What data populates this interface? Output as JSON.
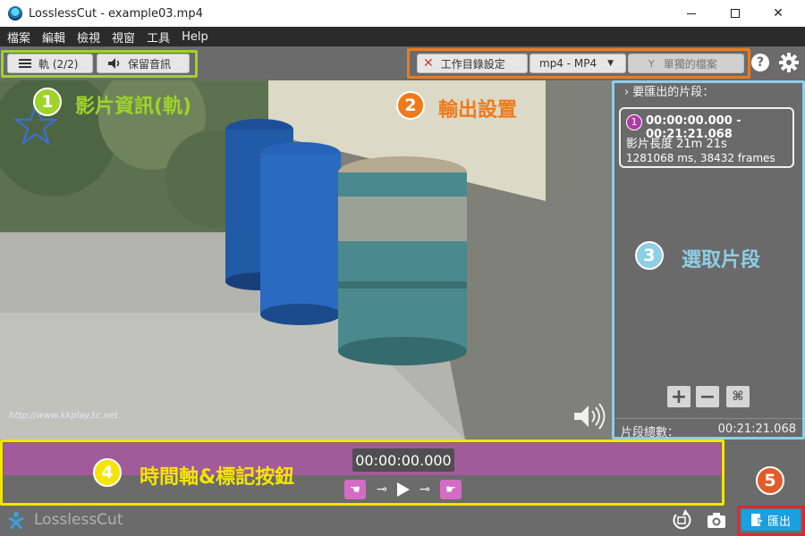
{
  "window": {
    "title": "LosslessCut - example03.mp4",
    "min_label": "",
    "max_label": "",
    "close_label": "✕"
  },
  "menu": [
    "檔案",
    "編輯",
    "檢視",
    "視窗",
    "工具",
    "Help"
  ],
  "toolbar": {
    "tracks_label": "軌 (2/2)",
    "keep_audio_label": "保留音訊",
    "workdir_label": "工作目錄設定",
    "format_label": "mp4 - MP4",
    "separate_files_label": "單獨的檔案",
    "help_label": "?"
  },
  "annotations": [
    {
      "num": "1",
      "text": "影片資訊(軌)",
      "color": "#9ed32a"
    },
    {
      "num": "2",
      "text": "輸出設置",
      "color": "#f07a1a"
    },
    {
      "num": "3",
      "text": "選取片段",
      "color": "#8ccfe6"
    },
    {
      "num": "4",
      "text": "時間軸&標記按鈕",
      "color": "#f4e500"
    },
    {
      "num": "5",
      "text": "",
      "color": "#e35b2a"
    }
  ],
  "segments_panel": {
    "header": "要匯出的片段：",
    "segment": {
      "index": "1",
      "range": "00:00:00.000 - 00:21:21.068",
      "length": "影片長度 21m 21s",
      "frames": "1281068 ms, 38432 frames"
    },
    "total_label": "片段總數：",
    "total_value": "00:21:21.068"
  },
  "timeline": {
    "timecode": "00:00:00.000"
  },
  "bottom": {
    "brand": "LosslessCut",
    "export_label": "匯出"
  },
  "video": {
    "watermark": "http://www.kkplay3c.net"
  },
  "colors": {
    "accent": "#1aa0e0",
    "timeline": "#a15b9a",
    "segment": "#b03aa7"
  }
}
